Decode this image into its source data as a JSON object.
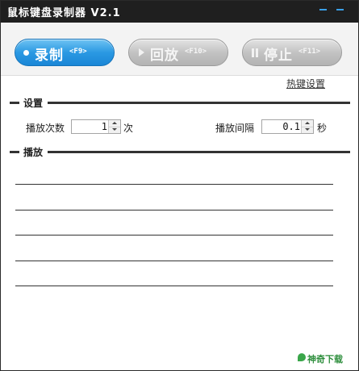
{
  "window": {
    "title": "鼠标键盘录制器 V2.1"
  },
  "toolbar": {
    "record": {
      "label": "录制",
      "key": "<F9>"
    },
    "play": {
      "label": "回放",
      "key": "<F10>"
    },
    "stop": {
      "label": "停止",
      "key": "<F11>"
    }
  },
  "links": {
    "hotkey_settings": "热键设置"
  },
  "settings": {
    "section_title": "设置",
    "play_count": {
      "label": "播放次数",
      "value": "1",
      "unit": "次"
    },
    "play_interval": {
      "label": "播放间隔",
      "value": "0.1",
      "unit": "秒"
    }
  },
  "playback": {
    "section_title": "播放"
  },
  "watermark": {
    "text": "神奇下载"
  },
  "colors": {
    "record_button": "#2b99e3",
    "disabled_button": "#c3c3c3",
    "titlebar": "#1f1f1f"
  }
}
